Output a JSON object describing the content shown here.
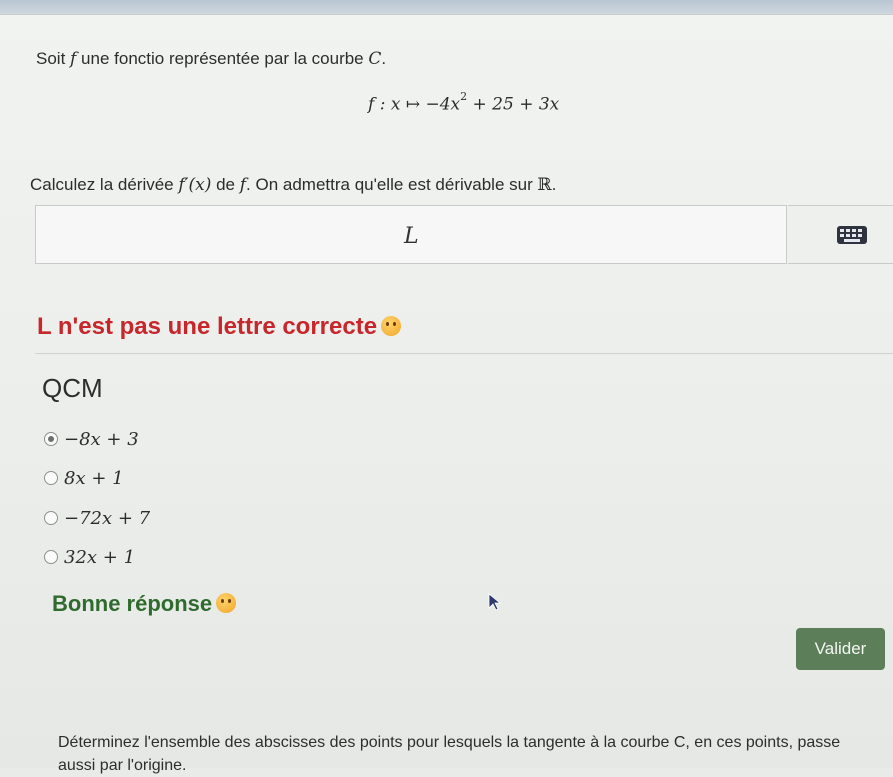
{
  "statement": {
    "prefix": "Soit ",
    "f": "f",
    "middle": " une fonctio",
    "rest": " représentée par la courbe ",
    "curve": "C",
    "end": "."
  },
  "formula": {
    "lhs": "f : x ↦ −4x",
    "exp": "2",
    "rhs": " + 25 + 3x"
  },
  "question": {
    "prefix": "Calculez la dérivée ",
    "derivative": "f′(x)",
    "middle": " de ",
    "f": "f",
    "suffix": ". On admettra qu'elle est dérivable sur ",
    "reals": "ℝ",
    "end": "."
  },
  "answer_input": {
    "value": "L"
  },
  "keyboard": {
    "icon": "keyboard-icon"
  },
  "feedback_wrong": {
    "text": "L n'est pas une lettre correcte",
    "icon": "sad-emoji-icon",
    "color": "#c7262a"
  },
  "qcm": {
    "title": "QCM",
    "options": [
      {
        "label": "−8x + 3",
        "checked": true
      },
      {
        "label": "8x + 1",
        "checked": false
      },
      {
        "label": "−72x + 7",
        "checked": false
      },
      {
        "label": "32x + 1",
        "checked": false
      }
    ]
  },
  "feedback_right": {
    "text": "Bonne réponse",
    "icon": "smile-emoji-icon",
    "color": "#2f6b2e"
  },
  "valider_button": {
    "label": "Valider",
    "color": "#5c7f5a"
  },
  "next_question": {
    "text": "Déterminez l'ensemble des abscisses des points pour lesquels la tangente à la courbe C, en ces points, passe aussi par l'origine."
  }
}
